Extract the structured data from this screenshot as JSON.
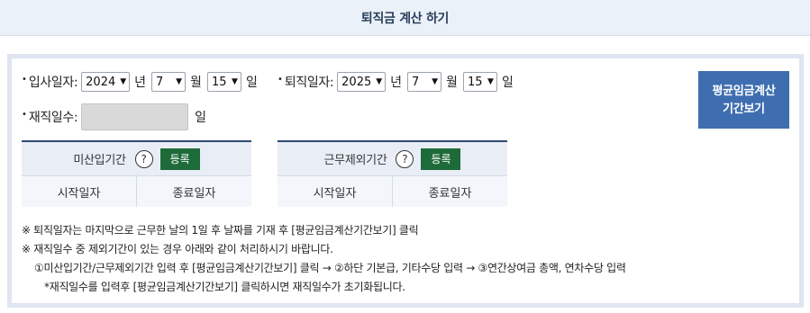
{
  "header": {
    "title": "퇴직금 계산 하기"
  },
  "hire": {
    "label": "입사일자:",
    "year": "2024",
    "month": "7",
    "day": "15"
  },
  "retire": {
    "label": "퇴직일자:",
    "year": "2025",
    "month": "7",
    "day": "15"
  },
  "units": {
    "year": "년",
    "month": "월",
    "day": "일"
  },
  "service_days": {
    "label": "재직일수:",
    "value": "",
    "unit": "일"
  },
  "avg_wage_button": {
    "line1": "평균임금계산",
    "line2": "기간보기"
  },
  "unpaid_period": {
    "title": "미산입기간",
    "help": "?",
    "register": "등록",
    "start_col": "시작일자",
    "end_col": "종료일자"
  },
  "excluded_period": {
    "title": "근무제외기간",
    "help": "?",
    "register": "등록",
    "start_col": "시작일자",
    "end_col": "종료일자"
  },
  "notes": [
    "※ 퇴직일자는 마지막으로 근무한 날의 1일 후 날짜를 기재 후 [평균임금계산기간보기] 클릭",
    "※ 재직일수 중 제외기간이 있는 경우 아래와 같이 처리하시기 바랍니다.",
    "①미산입기간/근무제외기간 입력 후 [평균임금계산기간보기] 클릭 → ②하단 기본급, 기타수당 입력 → ③연간상여금 총액, 연차수당 입력",
    "*재직일수를 입력후 [평균임금계산기간보기] 클릭하시면 재직일수가 초기화됩니다."
  ]
}
